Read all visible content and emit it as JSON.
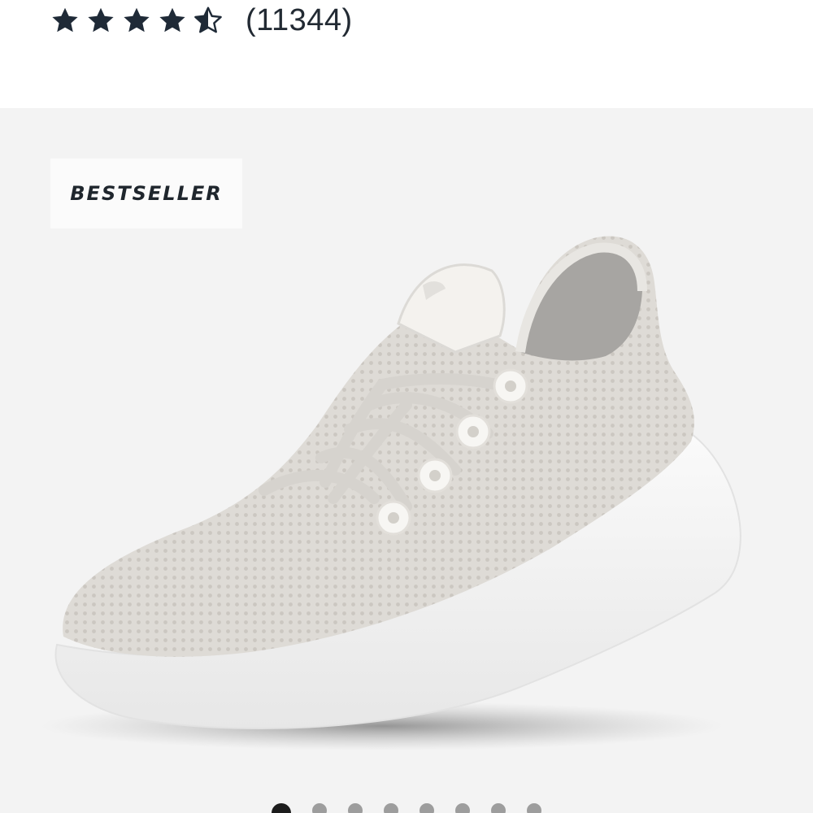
{
  "rating": {
    "value": 4.5,
    "max": 5,
    "review_count": "(11344)",
    "star_color": "#1f2a37"
  },
  "product": {
    "badge": "BESTSELLER",
    "image_icon": "sneaker-image",
    "panel_color": "#f3f3f3"
  },
  "carousel": {
    "slide_count": 8,
    "active_index": 0
  }
}
